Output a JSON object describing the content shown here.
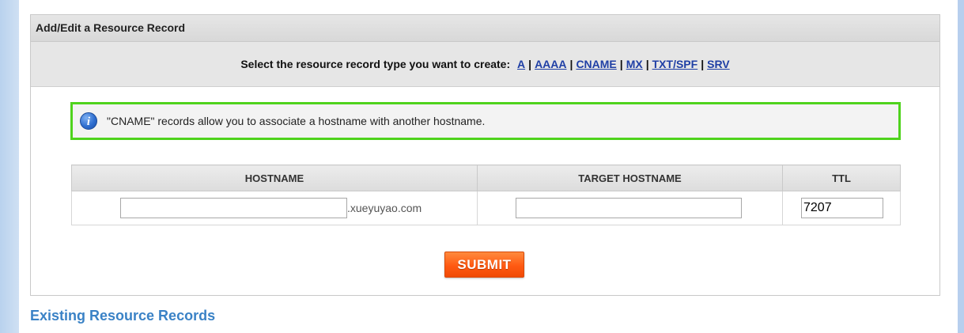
{
  "panel": {
    "title": "Add/Edit a Resource Record"
  },
  "type_selector": {
    "prompt": "Select the resource record type you want to create:",
    "types": [
      "A",
      "AAAA",
      "CNAME",
      "MX",
      "TXT/SPF",
      "SRV"
    ],
    "separator": "|"
  },
  "info": {
    "icon": "info-icon",
    "message": "\"CNAME\" records allow you to associate a hostname with another hostname."
  },
  "table": {
    "headers": [
      "HOSTNAME",
      "TARGET HOSTNAME",
      "TTL"
    ],
    "hostname_value": "",
    "domain_suffix": ".xueyuyao.com",
    "target_value": "",
    "ttl_value": "7207"
  },
  "submit": {
    "label": "SUBMIT"
  },
  "existing": {
    "title": "Existing Resource Records"
  },
  "colors": {
    "info_border": "#4fd31d",
    "link": "#1f3fa5",
    "submit": "#ff5a12",
    "section_title": "#3a82c6"
  }
}
